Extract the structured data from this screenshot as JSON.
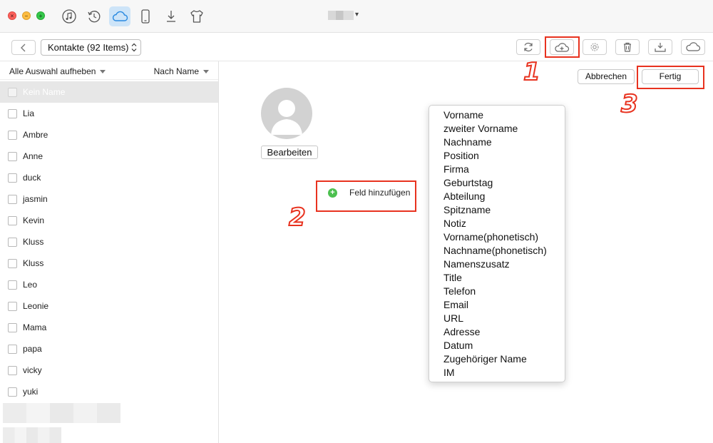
{
  "toolbar": {
    "category_label": "Kontakte (92 Items)",
    "updown_glyph": "⌃⌄"
  },
  "sidebar": {
    "select_toggle_label": "Alle Auswahl aufheben",
    "sort_label": "Nach Name",
    "contacts": [
      {
        "name": "Kein Name",
        "selected": true
      },
      {
        "name": "Lia"
      },
      {
        "name": "Ambre"
      },
      {
        "name": "Anne"
      },
      {
        "name": "duck"
      },
      {
        "name": "jasmin"
      },
      {
        "name": "Kevin"
      },
      {
        "name": "Kluss"
      },
      {
        "name": "Kluss"
      },
      {
        "name": "Leo"
      },
      {
        "name": "Leonie"
      },
      {
        "name": "Mama"
      },
      {
        "name": "papa"
      },
      {
        "name": "vicky"
      },
      {
        "name": "yuki"
      }
    ]
  },
  "editor": {
    "edit_photo_label": "Bearbeiten",
    "add_field_label": "Feld hinzufügen",
    "cancel_label": "Abbrechen",
    "done_label": "Fertig"
  },
  "field_menu": {
    "items": [
      "Vorname",
      "zweiter Vorname",
      "Nachname",
      "Position",
      "Firma",
      "Geburtstag",
      "Abteilung",
      "Spitzname",
      "Notiz",
      "Vorname(phonetisch)",
      "Nachname(phonetisch)",
      "Namenszusatz",
      "Title",
      "Telefon",
      "Email",
      "URL",
      "Adresse",
      "Datum",
      "Zugehöriger Name",
      "IM"
    ]
  },
  "annotations": {
    "step1": "1",
    "step2": "2",
    "step3": "3"
  },
  "colors": {
    "annotation": "#e8321f",
    "active_tab": "#cde4f8",
    "add_icon": "#4cc04f"
  }
}
